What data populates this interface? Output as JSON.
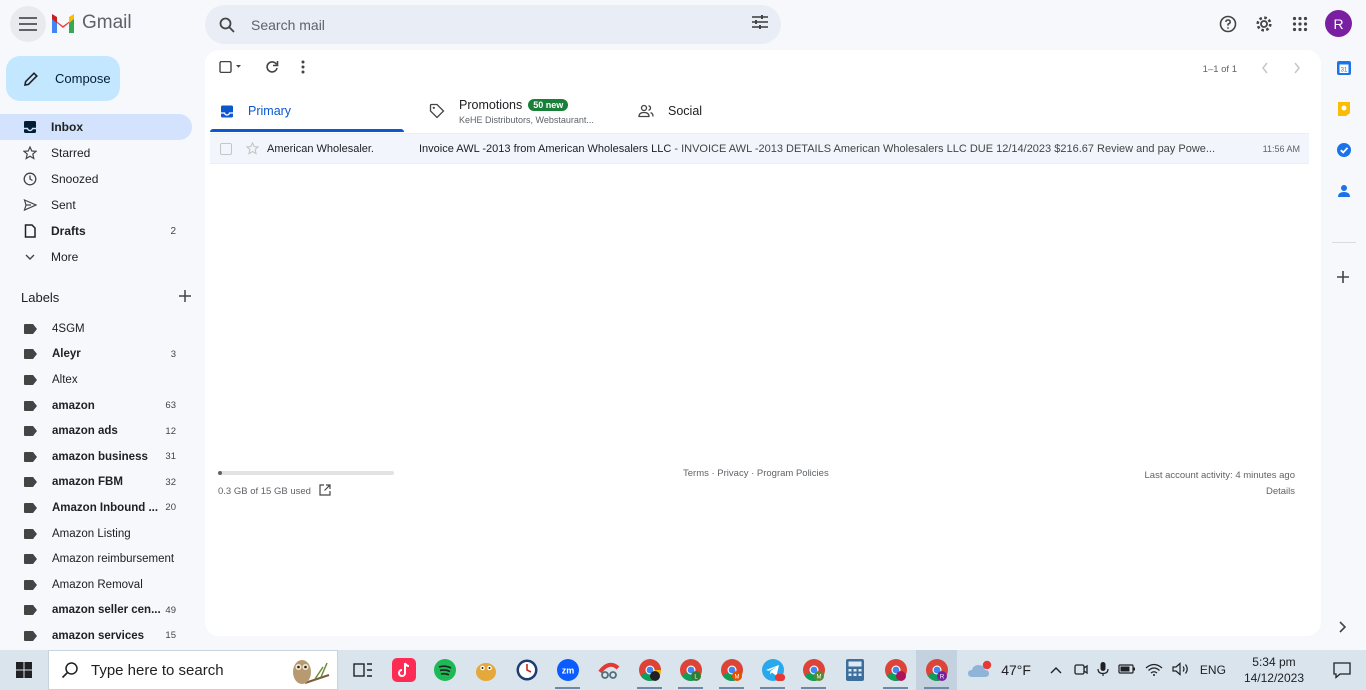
{
  "app": {
    "logo_text": "Gmail",
    "avatar_letter": "R"
  },
  "search": {
    "placeholder": "Search mail"
  },
  "compose": {
    "label": "Compose"
  },
  "nav": [
    {
      "label": "Inbox",
      "count": "",
      "icon": "inbox-icon",
      "active": true
    },
    {
      "label": "Starred",
      "count": "",
      "icon": "star-icon"
    },
    {
      "label": "Snoozed",
      "count": "",
      "icon": "clock-icon"
    },
    {
      "label": "Sent",
      "count": "",
      "icon": "send-icon"
    },
    {
      "label": "Drafts",
      "count": "2",
      "icon": "draft-icon",
      "bold": true
    },
    {
      "label": "More",
      "count": "",
      "icon": "chevron-down-icon"
    }
  ],
  "labels_heading": "Labels",
  "labels": [
    {
      "label": "4SGM",
      "count": ""
    },
    {
      "label": "Aleyr",
      "count": "3",
      "bold": true
    },
    {
      "label": "Altex",
      "count": ""
    },
    {
      "label": "amazon",
      "count": "63",
      "bold": true
    },
    {
      "label": "amazon ads",
      "count": "12",
      "bold": true
    },
    {
      "label": "amazon business",
      "count": "31",
      "bold": true
    },
    {
      "label": "amazon FBM",
      "count": "32",
      "bold": true
    },
    {
      "label": "Amazon Inbound ...",
      "count": "20",
      "bold": true
    },
    {
      "label": "Amazon Listing",
      "count": ""
    },
    {
      "label": "Amazon reimbursement",
      "count": ""
    },
    {
      "label": "Amazon Removal",
      "count": ""
    },
    {
      "label": "amazon seller cen...",
      "count": "49",
      "bold": true
    },
    {
      "label": "amazon services",
      "count": "15",
      "bold": true
    }
  ],
  "pager": {
    "text": "1–1 of 1"
  },
  "tabs": {
    "primary": "Primary",
    "promotions": "Promotions",
    "promotions_badge": "50 new",
    "promotions_sub": "KeHE Distributors, Webstaurant...",
    "social": "Social"
  },
  "emails": [
    {
      "sender": "American Wholesaler.",
      "subject": "Invoice AWL -2013 from American Wholesalers LLC",
      "snippet": " - INVOICE AWL -2013 DETAILS American Wholesalers LLC DUE 12/14/2023 $216.67 Review and pay Powe...",
      "time": "11:56 AM"
    }
  ],
  "footer": {
    "storage": "0.3 GB of 15 GB used",
    "storage_fraction": 0.02,
    "links": "Terms · Privacy · Program Policies",
    "activity": "Last account activity: 4 minutes ago",
    "details": "Details"
  },
  "taskbar": {
    "search_placeholder": "Type here to search",
    "weather": "47°F",
    "language": "ENG",
    "time": "5:34 pm",
    "date": "14/12/2023"
  },
  "colors": {
    "accent": "#0b57d0",
    "compose_bg": "#c2e7ff",
    "active_nav": "#d3e3fd",
    "badge": "#188038",
    "avatar": "#7b1fa2"
  }
}
